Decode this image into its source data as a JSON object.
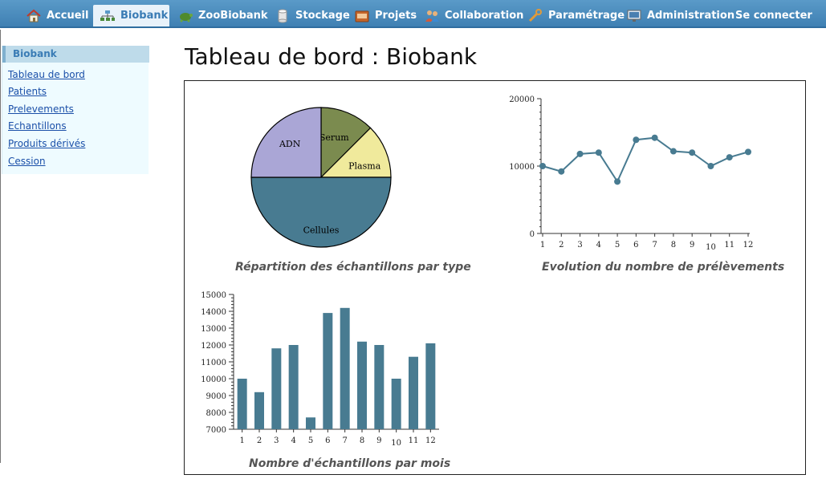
{
  "nav": {
    "items": [
      {
        "label": "Accueil",
        "icon": "home-icon",
        "active": false
      },
      {
        "label": "Biobank",
        "icon": "network-icon",
        "active": true
      },
      {
        "label": "ZooBiobank",
        "icon": "turtle-icon",
        "active": false
      },
      {
        "label": "Stockage",
        "icon": "storage-cylinder-icon",
        "active": false
      },
      {
        "label": "Projets",
        "icon": "folder-icon",
        "active": false
      },
      {
        "label": "Collaboration",
        "icon": "people-icon",
        "active": false
      },
      {
        "label": "Paramétrage",
        "icon": "wrench-icon",
        "active": false
      },
      {
        "label": "Administration",
        "icon": "monitor-icon",
        "active": false
      },
      {
        "label": "Se connecter",
        "icon": "",
        "active": false
      }
    ]
  },
  "sidebar": {
    "title": "Biobank",
    "links": [
      "Tableau de bord",
      "Patients",
      "Prelevements",
      "Echantillons",
      "Produits dérivés",
      "Cession"
    ]
  },
  "page": {
    "title": "Tableau de bord : Biobank"
  },
  "colors": {
    "pie_adn": "#aaa6d6",
    "pie_serum": "#7b8b4f",
    "pie_plasma": "#f0ea9c",
    "pie_cellules": "#487b91",
    "series": "#487b91"
  },
  "chart_data": [
    {
      "type": "pie",
      "title": "Répartition des échantillons par type",
      "categories": [
        "Serum",
        "Plasma",
        "Cellules",
        "ADN"
      ],
      "values": [
        12.5,
        12.5,
        50,
        25
      ]
    },
    {
      "type": "line",
      "title": "Evolution du nombre de prélèvements",
      "x": [
        1,
        2,
        3,
        4,
        5,
        6,
        7,
        8,
        9,
        10,
        11,
        12
      ],
      "y": [
        10000,
        9200,
        11800,
        12000,
        7700,
        13900,
        14200,
        12200,
        12000,
        10000,
        11300,
        12100
      ],
      "yticks": [
        0,
        10000,
        20000
      ],
      "ylim": [
        0,
        20000
      ]
    },
    {
      "type": "bar",
      "title": "Nombre d'échantillons par mois",
      "categories": [
        "1",
        "2",
        "3",
        "4",
        "5",
        "6",
        "7",
        "8",
        "9",
        "10",
        "11",
        "12"
      ],
      "values": [
        10000,
        9200,
        11800,
        12000,
        7700,
        13900,
        14200,
        12200,
        12000,
        10000,
        11300,
        12100
      ],
      "yticks": [
        7000,
        8000,
        9000,
        10000,
        11000,
        12000,
        13000,
        14000,
        15000
      ],
      "ylim": [
        7000,
        15000
      ]
    }
  ]
}
